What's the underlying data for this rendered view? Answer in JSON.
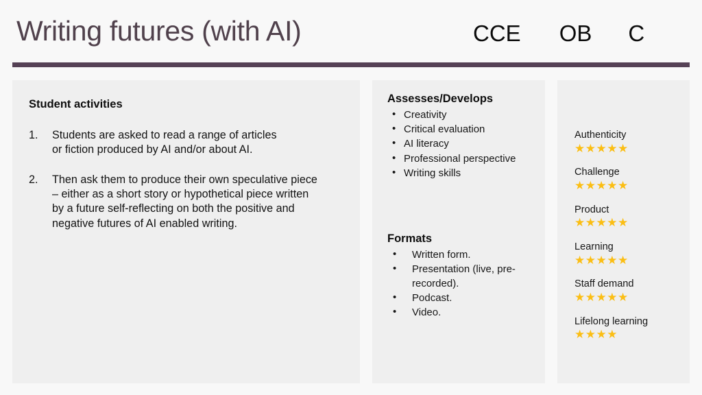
{
  "slide": {
    "title": "Writing futures (with AI)",
    "header_codes": [
      "CCE",
      "OB",
      "C"
    ],
    "accent_bar_color": "#554155",
    "title_color": "#50414c",
    "panel_bg": "#efefef",
    "background": "#f8f8f8",
    "star_color": "#fbbe14"
  },
  "left_panel": {
    "heading": "Student activities",
    "items": [
      {
        "number": "1.",
        "text": "Students are asked to read a range of articles\nor fiction produced by AI and/or about AI."
      },
      {
        "number": "2.",
        "text": "Then ask them to produce their own speculative piece\n– either as a short story or hypothetical piece written\nby a future self-reflecting on both the positive and\nnegative futures of AI enabled writing."
      }
    ]
  },
  "middle_panel": {
    "assesses": {
      "heading": "Assesses/Develops",
      "bullets": [
        "Creativity",
        "Critical evaluation",
        "AI literacy",
        "Professional perspective",
        "Writing skills"
      ]
    },
    "formats": {
      "heading": "Formats",
      "bullets": [
        "Written form.",
        "Presentation (live, pre-recorded).",
        "Podcast.",
        "Video."
      ]
    }
  },
  "right_panel": {
    "ratings": [
      {
        "label": "Authenticity",
        "stars": 5,
        "max": 5
      },
      {
        "label": "Challenge",
        "stars": 5,
        "max": 5
      },
      {
        "label": "Product",
        "stars": 5,
        "max": 5
      },
      {
        "label": "Learning",
        "stars": 5,
        "max": 5
      },
      {
        "label": "Staff demand",
        "stars": 5,
        "max": 5
      },
      {
        "label": "Lifelong learning",
        "stars": 4,
        "max": 5
      }
    ]
  }
}
